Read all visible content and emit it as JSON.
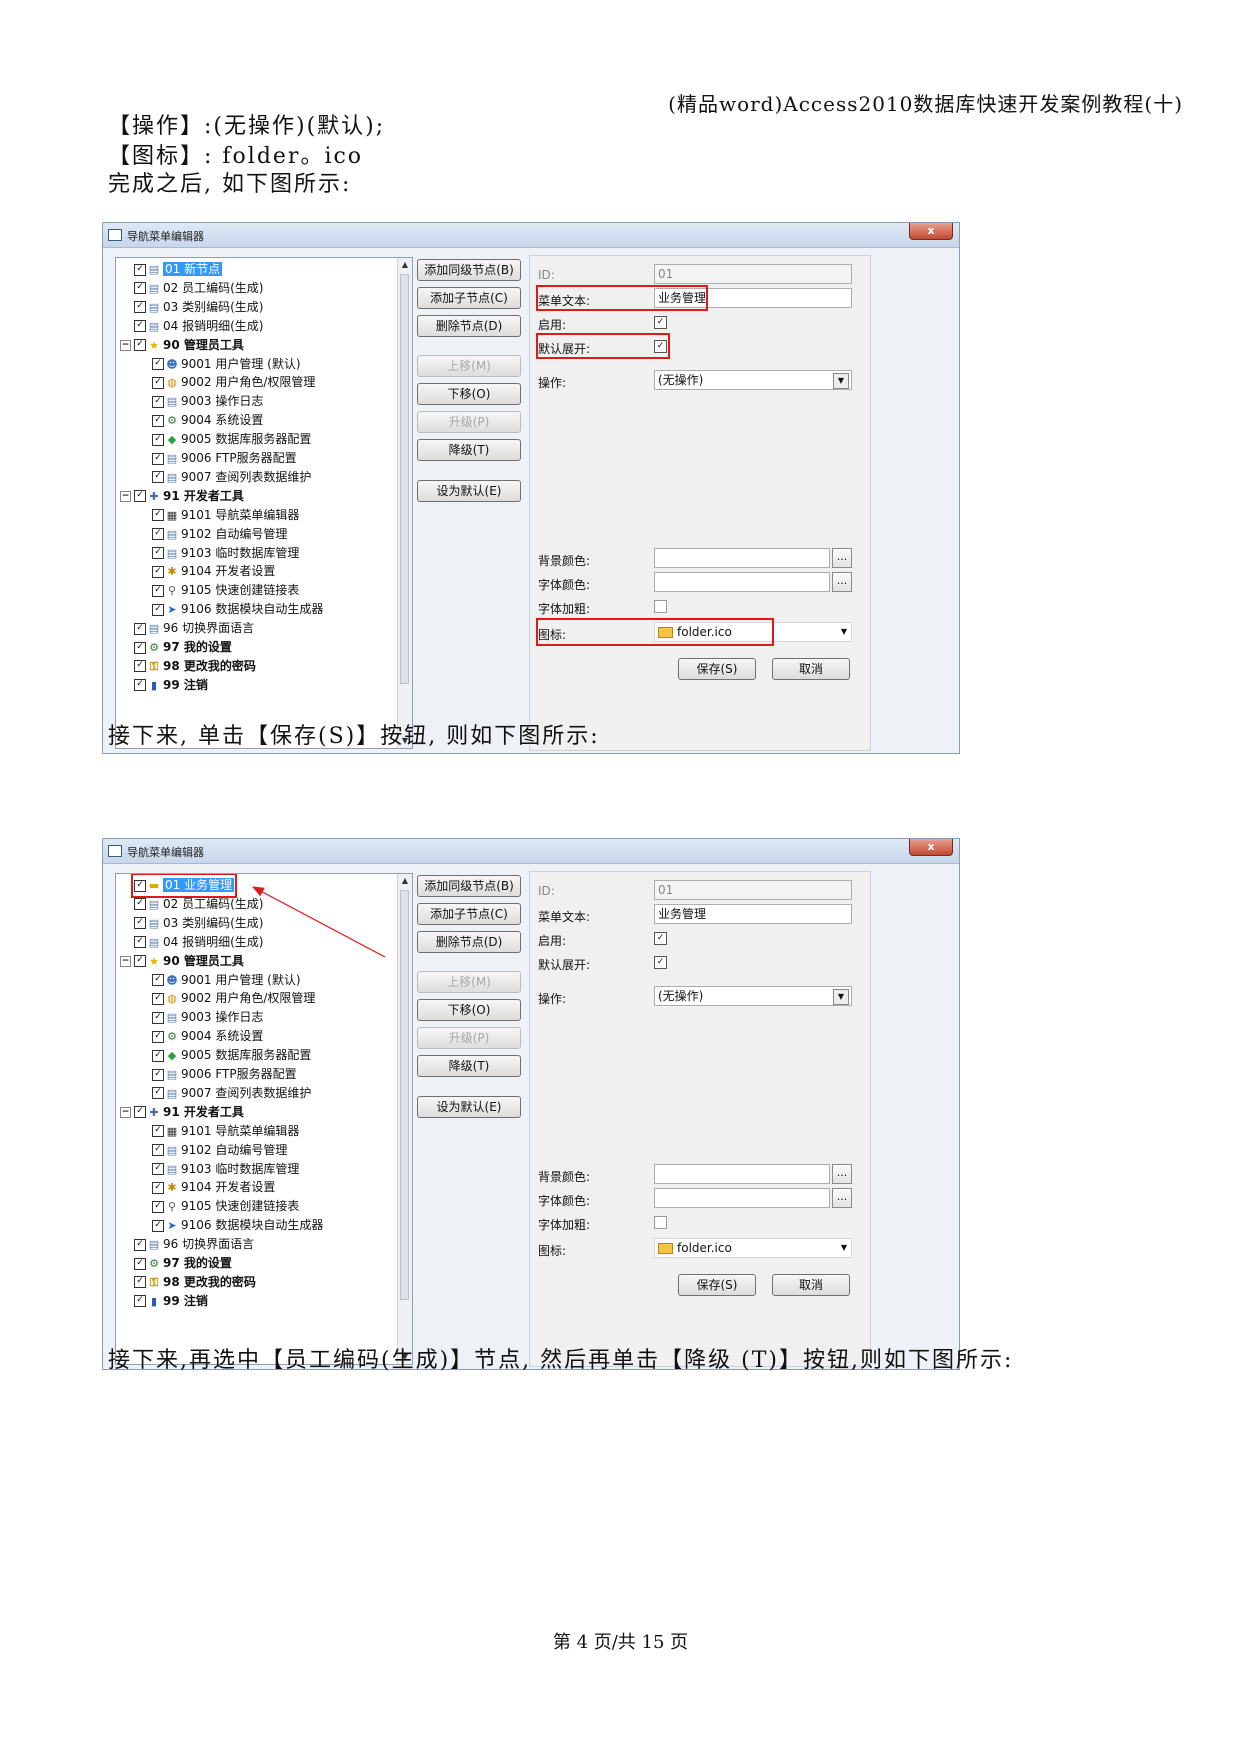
{
  "header": "(精品word)Access2010数据库快速开发案例教程(十)",
  "paragraphs": {
    "op": "【操作】:(无操作)(默认);",
    "icon": "【图标】: folder。ico",
    "after": "完成之后, 如下图所示:",
    "save_click": "接下来, 单击【保存(S)】按钮, 则如下图所示:",
    "next": "接下来,再选中【员工编码(生成)】节点, 然后再单击【降级 (T)】按钮,则如下图所示:"
  },
  "footer": "第 4 页/共 15 页",
  "window": {
    "title": "导航菜单编辑器",
    "close": "x",
    "tree1": [
      {
        "label": "01 新节点",
        "bold": false,
        "icon": "document-icon"
      },
      {
        "label": "02 员工编码(生成)",
        "bold": false,
        "icon": "document-icon"
      },
      {
        "label": "03 类别编码(生成)",
        "bold": false,
        "icon": "document-icon"
      },
      {
        "label": "04 报销明细(生成)",
        "bold": false,
        "icon": "document-icon"
      },
      {
        "label": "90 管理员工具",
        "bold": true,
        "icon": "star-icon"
      },
      {
        "label": "9001 用户管理 (默认)",
        "bold": false,
        "icon": "users-icon"
      },
      {
        "label": "9002 用户角色/权限管理",
        "bold": false,
        "icon": "lock-icon"
      },
      {
        "label": "9003 操作日志",
        "bold": false,
        "icon": "document-icon"
      },
      {
        "label": "9004 系统设置",
        "bold": false,
        "icon": "settings-icon"
      },
      {
        "label": "9005 数据库服务器配置",
        "bold": false,
        "icon": "database-icon"
      },
      {
        "label": "9006 FTP服务器配置",
        "bold": false,
        "icon": "document-icon"
      },
      {
        "label": "9007 查阅列表数据维护",
        "bold": false,
        "icon": "document-icon"
      },
      {
        "label": "91 开发者工具",
        "bold": true,
        "icon": "tools-icon"
      },
      {
        "label": "9101 导航菜单编辑器",
        "bold": false,
        "icon": "list-icon"
      },
      {
        "label": "9102 自动编号管理",
        "bold": false,
        "icon": "document-icon"
      },
      {
        "label": "9103 临时数据库管理",
        "bold": false,
        "icon": "document-icon"
      },
      {
        "label": "9104 开发者设置",
        "bold": false,
        "icon": "gear-icon"
      },
      {
        "label": "9105 快速创建链接表",
        "bold": false,
        "icon": "link-icon"
      },
      {
        "label": "9106 数据模块自动生成器",
        "bold": false,
        "icon": "wizard-icon"
      },
      {
        "label": "96 切换界面语言",
        "bold": false,
        "icon": "document-icon"
      },
      {
        "label": "97 我的设置",
        "bold": true,
        "icon": "settings-icon"
      },
      {
        "label": "98 更改我的密码",
        "bold": true,
        "icon": "key-icon"
      },
      {
        "label": "99 注销",
        "bold": true,
        "icon": "logout-icon"
      }
    ],
    "tree2_first": "01 业务管理",
    "buttons": {
      "add_sibling": "添加同级节点(B)",
      "add_child": "添加子节点(C)",
      "delete": "删除节点(D)",
      "up": "上移(M)",
      "down": "下移(O)",
      "promote": "升级(P)",
      "demote": "降级(T)",
      "set_default": "设为默认(E)"
    },
    "fields": {
      "id_label": "ID:",
      "id_value": "01",
      "text_label": "菜单文本:",
      "text_value": "业务管理",
      "enabled_label": "启用:",
      "expand_label": "默认展开:",
      "action_label": "操作:",
      "action_value": "(无操作)",
      "bg_label": "背景颜色:",
      "fg_label": "字体颜色:",
      "bold_label": "字体加粗:",
      "icon_label": "图标:",
      "icon_value": "folder.ico",
      "dots": "...",
      "save": "保存(S)",
      "cancel": "取消"
    }
  }
}
